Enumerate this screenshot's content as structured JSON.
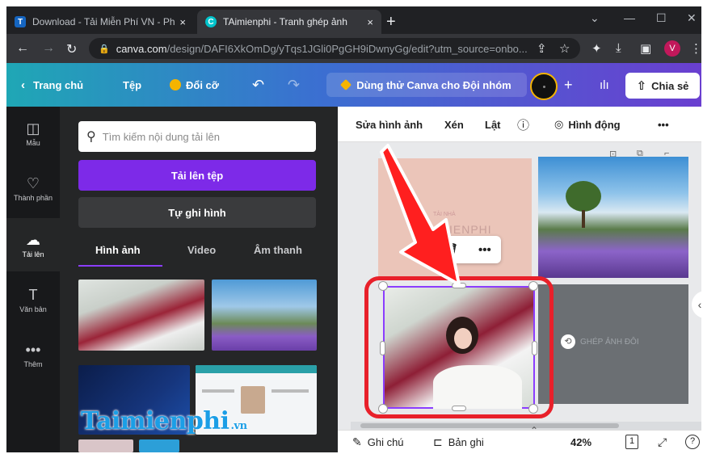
{
  "browser": {
    "tabs": [
      {
        "title": "Download - Tải Miễn Phí VN - Ph",
        "favicon": "T"
      },
      {
        "title": "TAimienphi - Tranh ghép ảnh",
        "favicon": "C"
      }
    ],
    "new_tab": "+",
    "close": "×",
    "url_host": "canva.com",
    "url_path": "/design/DAFI6XkOmDg/yTqs1JGli0PgGH9iDwnyGg/edit?utm_source=onbo...",
    "profile_letter": "V"
  },
  "canva_header": {
    "home": "Trang chủ",
    "file": "Tệp",
    "resize": "Đổi cỡ",
    "trial": "Dùng thử Canva cho Đội nhóm",
    "share": "Chia sẻ",
    "brand_color": "#7d2ae8"
  },
  "rail": [
    {
      "icon": "layout-icon",
      "label": "Mẫu"
    },
    {
      "icon": "elements-icon",
      "label": "Thành phần"
    },
    {
      "icon": "upload-cloud-icon",
      "label": "Tải lên"
    },
    {
      "icon": "text-icon",
      "label": "Văn bản"
    },
    {
      "icon": "more-icon",
      "label": "Thêm"
    }
  ],
  "panel": {
    "search_placeholder": "Tìm kiếm nội dung tải lên",
    "upload_button": "Tải lên tệp",
    "record_button": "Tự ghi hình",
    "tabs": [
      "Hình ảnh",
      "Video",
      "Âm thanh"
    ],
    "active_tab": "Hình ảnh"
  },
  "watermark": {
    "text": "Taimienphi",
    "suffix": ".vn"
  },
  "context_toolbar": {
    "edit_image": "Sửa hình ảnh",
    "crop": "Xén",
    "flip": "Lật",
    "animate": "Hình động",
    "more": "•••"
  },
  "canvas": {
    "pink_small_text": "TẢI NHÀ",
    "pink_big_text": "IENPHI",
    "gray_caption": "GHÉP ẢNH ĐÔI",
    "highlight_color": "#e8202a"
  },
  "bottom_bar": {
    "notes": "Ghi chú",
    "recording": "Bản ghi",
    "zoom": "42%",
    "page_count": "1",
    "help": "?"
  }
}
